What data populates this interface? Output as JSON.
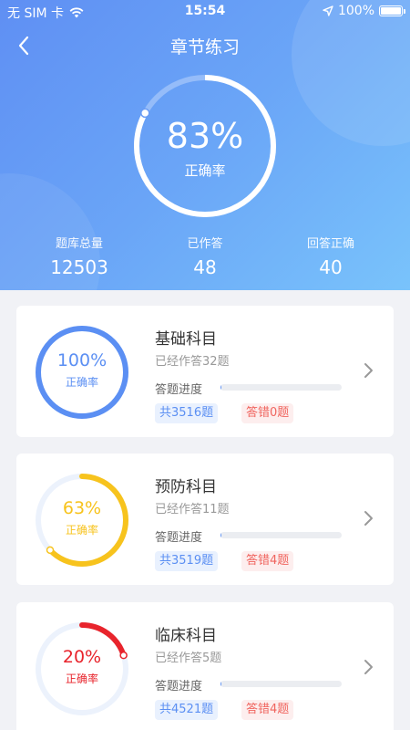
{
  "status_bar": {
    "carrier": "无 SIM 卡",
    "time": "15:54",
    "battery": "100%"
  },
  "nav": {
    "title": "章节练习"
  },
  "summary": {
    "accuracy": 83,
    "accuracy_text": "83%",
    "accuracy_label": "正确率",
    "stats": [
      {
        "label": "题库总量",
        "value": "12503"
      },
      {
        "label": "已作答",
        "value": "48"
      },
      {
        "label": "回答正确",
        "value": "40"
      }
    ]
  },
  "subjects": [
    {
      "title": "基础科目",
      "done": "已经作答32题",
      "progress_label": "答题进度",
      "progress": 0.009,
      "total": "共3516题",
      "wrong": "答错0题",
      "accuracy": 100,
      "accuracy_text": "100%",
      "accuracy_label": "正确率",
      "color": "#5b8ff3"
    },
    {
      "title": "预防科目",
      "done": "已经作答11题",
      "progress_label": "答题进度",
      "progress": 0.003,
      "total": "共3519题",
      "wrong": "答错4题",
      "accuracy": 63,
      "accuracy_text": "63%",
      "accuracy_label": "正确率",
      "color": "#f7c31d"
    },
    {
      "title": "临床科目",
      "done": "已经作答5题",
      "progress_label": "答题进度",
      "progress": 0.001,
      "total": "共4521题",
      "wrong": "答错4题",
      "accuracy": 20,
      "accuracy_text": "20%",
      "accuracy_label": "正确率",
      "color": "#e8242c"
    }
  ],
  "icons": {
    "back": "back-arrow-icon",
    "signal": "wifi-icon",
    "location": "location-arrow-icon",
    "chevron": "chevron-right-icon"
  }
}
